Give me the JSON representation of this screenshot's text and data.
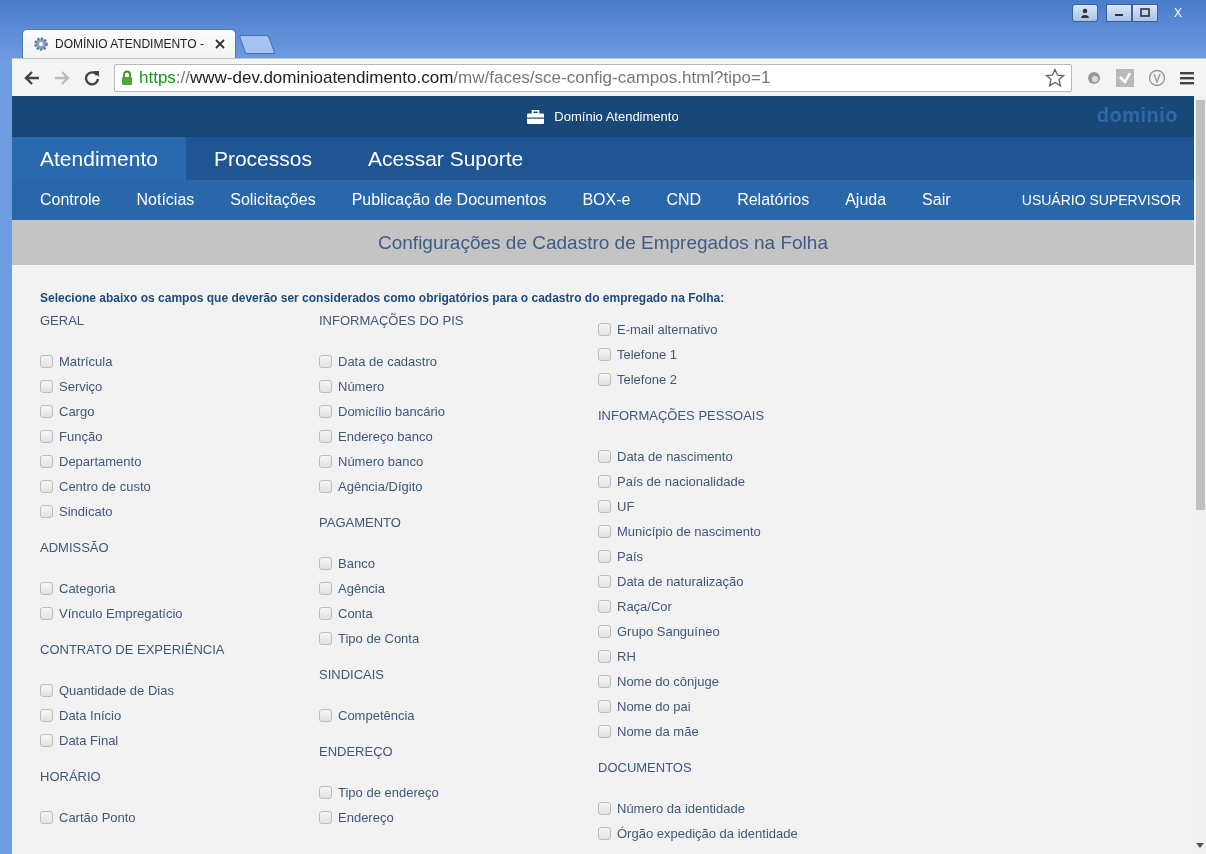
{
  "browser": {
    "tab": {
      "title": "DOMÍNIO ATENDIMENTO - ",
      "selected": true
    },
    "address": [
      {
        "kind": "scheme",
        "text": "https"
      },
      {
        "kind": "sep",
        "text": "://"
      },
      {
        "kind": "host",
        "text": "www-dev.dominioatendimento.com"
      },
      {
        "kind": "path",
        "text": "/mw/faces/sce-config-campos.html?tipo=1"
      }
    ],
    "forward_disabled": true,
    "window_controls": [
      "X"
    ]
  },
  "header": {
    "title": "Domínio Atendimento",
    "logo": "dominio"
  },
  "main_nav": [
    {
      "label": "Atendimento",
      "selected": true
    },
    {
      "label": "Processos",
      "selected": false
    },
    {
      "label": "Acessar Suporte",
      "selected": false
    }
  ],
  "sub_nav": [
    "Controle",
    "Notícias",
    "Solicitações",
    "Publicação de Documentos",
    "BOX-e",
    "CND",
    "Relatórios",
    "Ajuda",
    "Sair"
  ],
  "user": "USUÁRIO SUPERVISOR",
  "page_title": "Configurações de Cadastro de Empregados na Folha",
  "instruction": "Selecione abaixo os campos que deverão ser considerados como obrigatórios para o cadastro do empregado na Folha:",
  "columns": [
    [
      {
        "title": "GERAL",
        "items": [
          {
            "label": "Matrícula",
            "checked": false
          },
          {
            "label": "Serviço",
            "checked": false
          },
          {
            "label": "Cargo",
            "checked": false
          },
          {
            "label": "Função",
            "checked": false
          },
          {
            "label": "Departamento",
            "checked": false
          },
          {
            "label": "Centro de custo",
            "checked": false
          },
          {
            "label": "Sindicato",
            "checked": false
          }
        ]
      },
      {
        "title": "ADMISSÃO",
        "items": [
          {
            "label": "Categoria",
            "checked": false
          },
          {
            "label": "Vínculo Empregatício",
            "checked": false
          }
        ]
      },
      {
        "title": "CONTRATO DE EXPERIÊNCIA",
        "items": [
          {
            "label": "Quantidade de Dias",
            "checked": false
          },
          {
            "label": "Data Início",
            "checked": false
          },
          {
            "label": "Data Final",
            "checked": false
          }
        ]
      },
      {
        "title": "HORÁRIO",
        "items": [
          {
            "label": "Cartão Ponto",
            "checked": false
          }
        ]
      }
    ],
    [
      {
        "title": "INFORMAÇÕES DO PIS",
        "items": [
          {
            "label": "Data de cadastro",
            "checked": false
          },
          {
            "label": "Número",
            "checked": false
          },
          {
            "label": "Domicílio bancário",
            "checked": false
          },
          {
            "label": "Endereço banco",
            "checked": false
          },
          {
            "label": "Número banco",
            "checked": false
          },
          {
            "label": "Agência/Dígito",
            "checked": false
          }
        ]
      },
      {
        "title": "PAGAMENTO",
        "items": [
          {
            "label": "Banco",
            "checked": false
          },
          {
            "label": "Agência",
            "checked": false
          },
          {
            "label": "Conta",
            "checked": false
          },
          {
            "label": "Tipo de Conta",
            "checked": false
          }
        ]
      },
      {
        "title": "SINDICAIS",
        "items": [
          {
            "label": "Competência",
            "checked": false
          }
        ]
      },
      {
        "title": "ENDEREÇO",
        "items": [
          {
            "label": "Tipo de endereço",
            "checked": false
          },
          {
            "label": "Endereço",
            "checked": false
          }
        ]
      }
    ],
    [
      {
        "items": [
          {
            "label": "E-mail alternativo",
            "checked": false
          },
          {
            "label": "Telefone 1",
            "checked": false
          },
          {
            "label": "Telefone 2",
            "checked": false
          }
        ]
      },
      {
        "title": "INFORMAÇÕES PESSOAIS",
        "items": [
          {
            "label": "Data de nascimento",
            "checked": false
          },
          {
            "label": "País de nacionalidade",
            "checked": false
          },
          {
            "label": "UF",
            "checked": false
          },
          {
            "label": "Município de nascimento",
            "checked": false
          },
          {
            "label": "País",
            "checked": false
          },
          {
            "label": "Data de naturalização",
            "checked": false
          },
          {
            "label": "Raça/Cor",
            "checked": false
          },
          {
            "label": "Grupo Sanguíneo",
            "checked": false
          },
          {
            "label": "RH",
            "checked": false
          },
          {
            "label": "Nome do cônjuge",
            "checked": false
          },
          {
            "label": "Nome do pai",
            "checked": false
          },
          {
            "label": "Nome da mãe",
            "checked": false
          }
        ]
      },
      {
        "title": "DOCUMENTOS",
        "items": [
          {
            "label": "Número da identidade",
            "checked": false
          },
          {
            "label": "Órgão expedição da identidade",
            "checked": false
          }
        ]
      }
    ]
  ]
}
